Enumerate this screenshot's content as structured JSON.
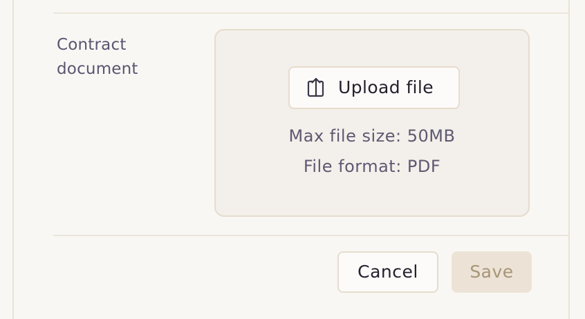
{
  "form": {
    "field_label": "Contract document"
  },
  "upload": {
    "button_label": "Upload file",
    "max_size_text": "Max file size: 50MB",
    "format_text": "File format: PDF",
    "icon": "upload-icon"
  },
  "actions": {
    "cancel_label": "Cancel",
    "save_label": "Save",
    "save_disabled": true
  },
  "colors": {
    "background": "#f9f7f4",
    "dropzone_bg": "#f3efea",
    "border": "#e5dccd",
    "label_text": "#5a5570",
    "primary_text": "#24212e",
    "save_bg": "#ece3d6",
    "save_text": "#a89478"
  }
}
